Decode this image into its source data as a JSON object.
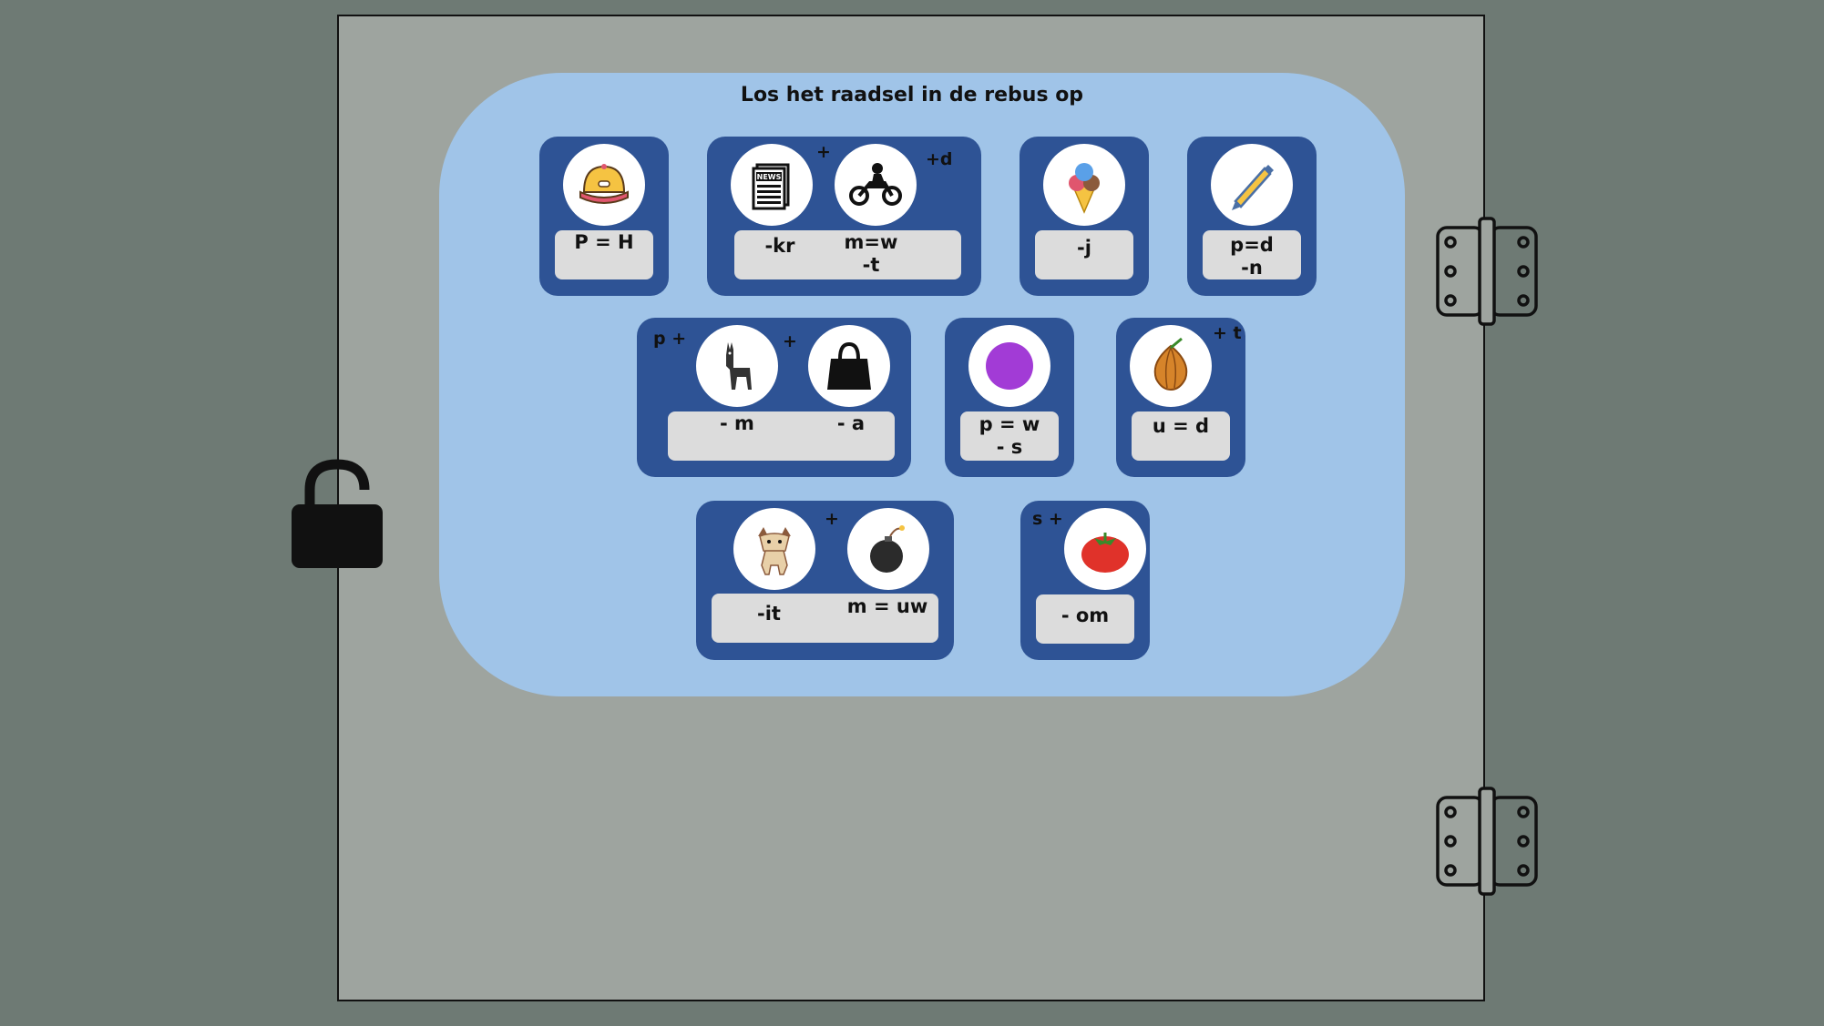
{
  "title": "Los het raadsel in de rebus op",
  "cards": {
    "cap": {
      "icon": "cap-icon",
      "clue": "P = H"
    },
    "newsbike": {
      "icons": [
        "newspaper-icon",
        "motorcycle-icon"
      ],
      "plus": "+",
      "suffix": "+d",
      "clue_left": "-kr",
      "clue_right_1": "m=w",
      "clue_right_2": "-t"
    },
    "icecream": {
      "icon": "ice-cream-icon",
      "clue": "-j"
    },
    "pen": {
      "icon": "pen-icon",
      "clue_1": "p=d",
      "clue_2": "-n"
    },
    "llamabag": {
      "icons": [
        "llama-icon",
        "handbag-icon"
      ],
      "prefix": "p +",
      "plus": "+",
      "clue_left": "- m",
      "clue_right": "- a"
    },
    "circle": {
      "icon": "purple-circle-icon",
      "clue_1": "p = w",
      "clue_2": "- s"
    },
    "onion": {
      "icon": "onion-icon",
      "suffix": "+ t",
      "clue": "u = d"
    },
    "goatbomb": {
      "icons": [
        "goat-icon",
        "bomb-icon"
      ],
      "plus": "+",
      "clue_left": "-it",
      "clue_right": "m = uw"
    },
    "tomato": {
      "icon": "tomato-icon",
      "prefix": "s +",
      "clue": "- om"
    }
  },
  "colors": {
    "background": "#6e7a74",
    "door": "#9ea49f",
    "panel": "#a0c4e8",
    "card": "#2e5395",
    "clue_box": "#dcdcdc"
  },
  "controls": {
    "lock": "unlocked-padlock-icon",
    "hinges": [
      "hinge-icon",
      "hinge-icon"
    ]
  }
}
